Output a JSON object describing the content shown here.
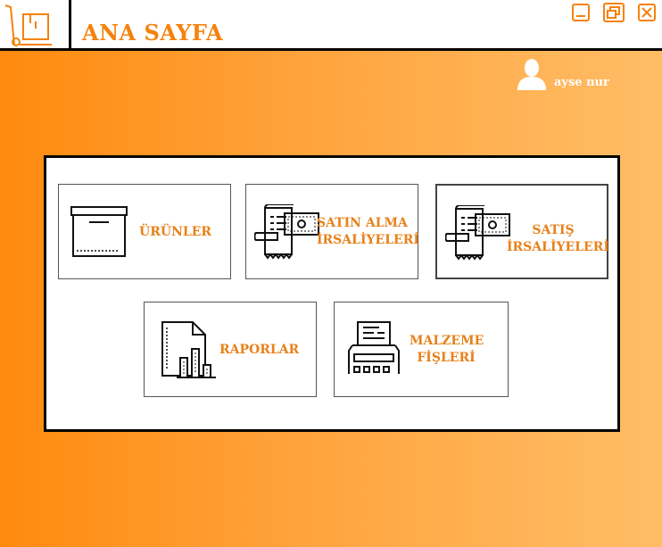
{
  "window": {
    "title": "ANA SAYFA",
    "controls": [
      "minimize-icon",
      "restore-icon",
      "close-icon"
    ],
    "accent_color": "#F5820D"
  },
  "user": {
    "name": "ayse nur",
    "icon": "user-icon"
  },
  "tiles": [
    {
      "label_line1": "ÜRÜNLER",
      "label_line2": "",
      "icon": "box-icon"
    },
    {
      "label_line1": "SATIN ALMA",
      "label_line2": "İRSALİYELERİ",
      "icon": "receipt-cash-icon"
    },
    {
      "label_line1": "SATIŞ",
      "label_line2": "İRSALİYELERİ",
      "icon": "receipt-cash-icon"
    },
    {
      "label_line1": "RAPORLAR",
      "label_line2": "",
      "icon": "report-chart-icon"
    },
    {
      "label_line1": "MALZEME",
      "label_line2": "FİŞLERİ",
      "icon": "receipt-printer-icon"
    }
  ],
  "colors": {
    "gradient_start": "#FF8A0E",
    "gradient_end": "#FFBD66",
    "label": "#E8811A"
  }
}
